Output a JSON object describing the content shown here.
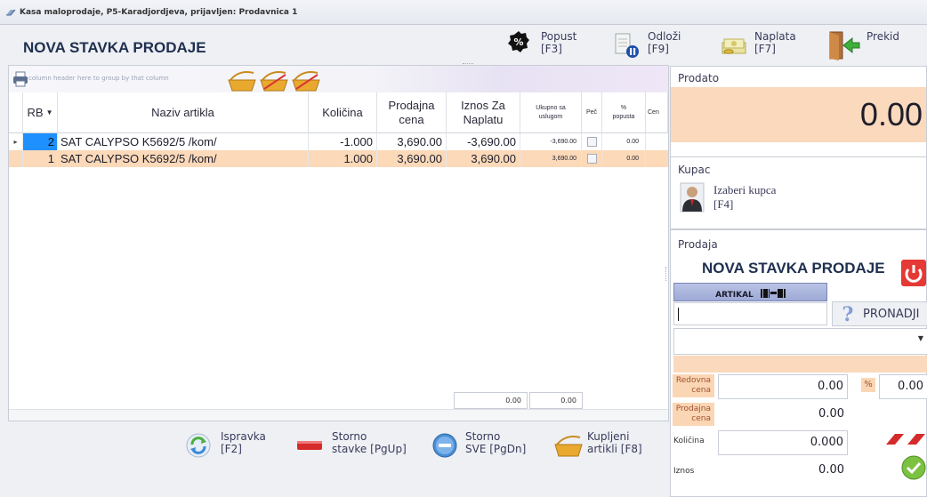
{
  "window": {
    "title": "Kasa maloprodaje, P5-Karadjordjeva, prijavljen: Prodavnica 1"
  },
  "header": {
    "title": "NOVA STAVKA PRODAJE"
  },
  "toolbar": {
    "popust": {
      "label": "Popust",
      "key": "[F3]"
    },
    "odlozi": {
      "label": "Odloži",
      "key": "[F9]"
    },
    "naplata": {
      "label": "Naplata",
      "key": "[F7]"
    },
    "prekid": {
      "label": "Prekid"
    }
  },
  "grid": {
    "group_hint": "column header here to group by that column",
    "columns": {
      "rb": "RB",
      "naziv": "Naziv artikla",
      "kolicina": "Količina",
      "prodajna_l1": "Prodajna",
      "prodajna_l2": "cena",
      "iznos_l1": "Iznos Za",
      "iznos_l2": "Naplatu",
      "ukupno_l1": "Ukupno sa",
      "ukupno_l2": "uslugom",
      "pec": "Peč",
      "popusta_l1": "%",
      "popusta_l2": "popusta",
      "cena": "Cen"
    },
    "rows": [
      {
        "rb": "2",
        "naziv": "SAT CALYPSO K5692/5 /kom/",
        "kolicina": "-1.000",
        "prodajna": "3,690.00",
        "iznos": "-3,690.00",
        "ukupno": "-3,690.00",
        "popusta": "0.00"
      },
      {
        "rb": "1",
        "naziv": "SAT CALYPSO K5692/5 /kom/",
        "kolicina": "1.000",
        "prodajna": "3,690.00",
        "iznos": "3,690.00",
        "ukupno": "3,690.00",
        "popusta": "0.00"
      }
    ],
    "footer": {
      "total1": "0.00",
      "total2": "0.00"
    }
  },
  "bottom_buttons": {
    "ispravka": {
      "l1": "Ispravka",
      "l2": "[F2]"
    },
    "storno_stavke": {
      "l1": "Storno",
      "l2": "stavke [PgUp]"
    },
    "storno_sve": {
      "l1": "Storno",
      "l2": "SVE [PgDn]"
    },
    "kupljeni": {
      "l1": "Kupljeni",
      "l2": "artikli [F8]"
    }
  },
  "side": {
    "prodato": {
      "title": "Prodato",
      "value": "0.00"
    },
    "kupac": {
      "title": "Kupac",
      "izaberi": "Izaberi kupca",
      "key": "[F4]"
    },
    "prodaja": {
      "title": "Prodaja",
      "heading": "NOVA STAVKA PRODAJE",
      "artikal": "ARTIKAL",
      "pronadji": "PRONADJI",
      "redovna_l1": "Redovna",
      "redovna_l2": "cena",
      "redovna_value": "0.00",
      "pct_symbol": "%",
      "pct_value": "0.00",
      "prodajna_l1": "Prodajna",
      "prodajna_l2": "cena",
      "prodajna_value": "0.00",
      "kolicina_label": "Količina",
      "kolicina_value": "0.000",
      "iznos_label": "Iznos",
      "iznos_value": "0.00"
    }
  },
  "colors": {
    "accent_blue": "#1e90ff",
    "selection": "#fbd9b9",
    "peach": "#fad9bd",
    "title": "#1f2f4f"
  }
}
